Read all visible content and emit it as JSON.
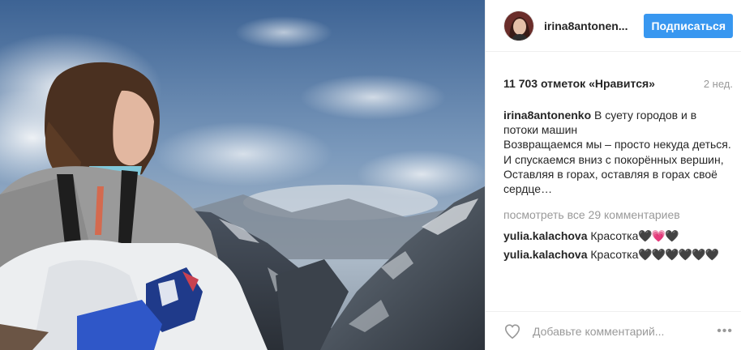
{
  "post": {
    "username": "irina8antonen...",
    "follow_label": "Подписаться",
    "likes": "11 703 отметок «Нравится»",
    "date": "2 нед.",
    "caption_author": "irina8antonenko",
    "caption_text": "В суету городов и в потоки машин\nВозвращаемся мы – просто некуда деться.\nИ спускаемся вниз с покорённых вершин,\nОставляя в горах, оставляя в горах своё сердце…",
    "view_all_comments": "посмотреть все 29 комментариев",
    "comments": [
      {
        "author": "yulia.kalachova",
        "text": "Красотка",
        "emoji": "🖤💗🖤"
      },
      {
        "author": "yulia.kalachova",
        "text": "Красотка",
        "emoji": "🖤🖤🖤🖤🖤🖤"
      }
    ],
    "comment_placeholder": "Добавьте комментарий...",
    "more_icon": "•••"
  },
  "colors": {
    "accent": "#3897f0",
    "muted": "#999999",
    "text": "#262626"
  }
}
